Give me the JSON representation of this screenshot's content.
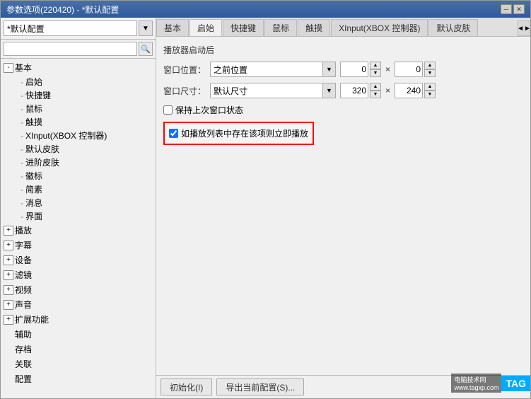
{
  "window": {
    "title": "参数选项(220420) - *默认配置",
    "title_bar_controls": [
      "pin",
      "close"
    ]
  },
  "left_panel": {
    "preset_label": "*默认配置",
    "preset_arrow": "v",
    "tree": {
      "root_items": [
        {
          "label": "基本",
          "expanded": true,
          "children": [
            "启始",
            "快捷键",
            "鼠标",
            "触摸",
            "XInput(XBOX 控制器)",
            "默认皮肤",
            "进阶皮肤",
            "徽标",
            "简素",
            "消息",
            "界面"
          ]
        },
        {
          "label": "播放",
          "expanded": false,
          "children": []
        },
        {
          "label": "字幕",
          "expanded": false,
          "children": []
        },
        {
          "label": "设备",
          "expanded": false,
          "children": []
        },
        {
          "label": "滤镜",
          "expanded": false,
          "children": []
        },
        {
          "label": "视频",
          "expanded": false,
          "children": []
        },
        {
          "label": "声音",
          "expanded": false,
          "children": []
        },
        {
          "label": "扩展功能",
          "expanded": false,
          "children": []
        },
        {
          "label": "辅助",
          "expanded": false,
          "children": []
        },
        {
          "label": "存档",
          "expanded": false,
          "children": []
        },
        {
          "label": "关联",
          "expanded": false,
          "children": []
        },
        {
          "label": "配置",
          "expanded": false,
          "children": []
        }
      ]
    }
  },
  "tabs": [
    {
      "label": "基本",
      "active": false
    },
    {
      "label": "启始",
      "active": true
    },
    {
      "label": "快捷键",
      "active": false
    },
    {
      "label": "鼠标",
      "active": false
    },
    {
      "label": "触摸",
      "active": false
    },
    {
      "label": "XInput(XBOX 控制器)",
      "active": false
    },
    {
      "label": "默认皮肤",
      "active": false
    }
  ],
  "tab_scroll_icon": "◄►",
  "main": {
    "section_title": "播放器启动后",
    "window_pos_label": "窗口位置：",
    "window_pos_value": "之前位置",
    "window_pos_x": "0",
    "window_pos_y": "0",
    "window_size_label": "窗口尺寸：",
    "window_size_value": "默认尺寸",
    "window_size_w": "320",
    "window_size_h": "240",
    "checkbox1_label": "保持上次窗口状态",
    "checkbox1_checked": false,
    "checkbox2_label": "如播放列表中存在该项则立即播放",
    "checkbox2_checked": true
  },
  "bottom": {
    "init_btn": "初始化(I)",
    "export_btn": "导出当前配置(S)..."
  },
  "watermark": {
    "site": "电脑技术网",
    "url": "www.tagxp.com",
    "tag": "TAG"
  },
  "icons": {
    "search": "🔍",
    "expand": "+",
    "collapse": "-",
    "spin_up": "▲",
    "spin_down": "▼",
    "dropdown_arrow": "▼",
    "pin": "─",
    "close": "✕"
  }
}
